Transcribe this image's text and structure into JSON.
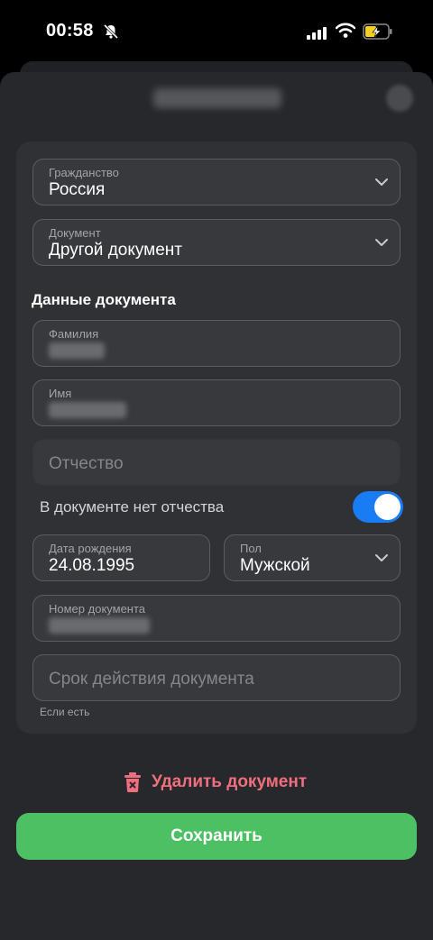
{
  "status_bar": {
    "time": "00:58"
  },
  "form": {
    "citizenship": {
      "label": "Гражданство",
      "value": "Россия"
    },
    "document_type": {
      "label": "Документ",
      "value": "Другой документ"
    },
    "section_title": "Данные документа",
    "last_name": {
      "label": "Фамилия"
    },
    "first_name": {
      "label": "Имя"
    },
    "middle_name": {
      "placeholder": "Отчество"
    },
    "no_middle_name": {
      "label": "В документе нет отчества",
      "enabled": true
    },
    "birth_date": {
      "label": "Дата рождения",
      "value": "24.08.1995"
    },
    "gender": {
      "label": "Пол",
      "value": "Мужской"
    },
    "document_number": {
      "label": "Номер документа"
    },
    "expiry": {
      "placeholder": "Срок действия документа",
      "hint": "Если есть"
    }
  },
  "actions": {
    "delete_label": "Удалить документ",
    "save_label": "Сохранить"
  },
  "colors": {
    "accent_green": "#4cc062",
    "toggle_blue": "#1a7cf5",
    "danger": "#ef6f7e"
  }
}
